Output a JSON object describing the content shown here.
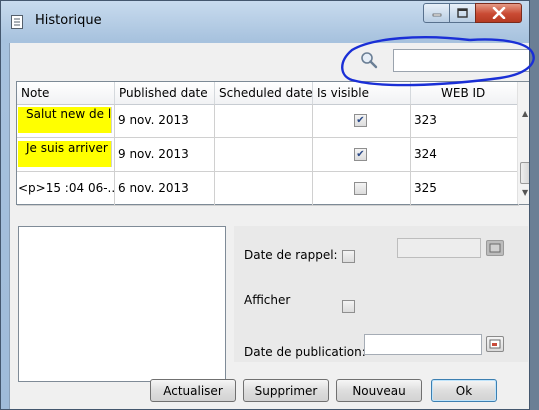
{
  "window": {
    "title": "Historique"
  },
  "search": {
    "value": "",
    "placeholder": ""
  },
  "table": {
    "columns": [
      "Note",
      "Published date",
      "Scheduled date",
      "Is visible",
      "WEB ID"
    ],
    "rows": [
      {
        "note": "Salut new de la machine",
        "published": "9 nov. 2013",
        "scheduled": "",
        "visible": true,
        "web_id": "323",
        "highlight": true
      },
      {
        "note": "Je suis arriver ok",
        "published": "9 nov. 2013",
        "scheduled": "",
        "visible": true,
        "web_id": "324",
        "highlight": true
      },
      {
        "note": "<p>15 :04 06-...",
        "published": "6 nov. 2013",
        "scheduled": "",
        "visible": false,
        "web_id": "325",
        "highlight": false
      }
    ]
  },
  "form": {
    "date_rappel_label": "Date de rappel:",
    "date_rappel_checked": false,
    "afficher_label": "Afficher",
    "afficher_checked": false,
    "date_publication_label": "Date de publication:",
    "date_publication_value": ""
  },
  "buttons": {
    "actualiser": "Actualiser",
    "supprimer": "Supprimer",
    "nouveau": "Nouveau",
    "ok": "Ok"
  },
  "colors": {
    "highlight": "#ffff00",
    "annotation": "#1a2fd6",
    "close": "#c94a33"
  }
}
